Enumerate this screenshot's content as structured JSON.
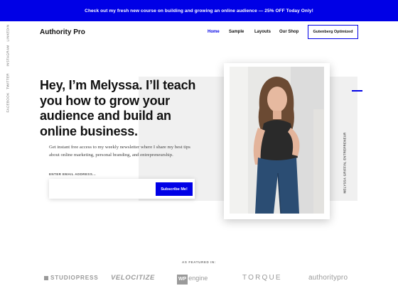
{
  "promo": {
    "text": "Check out my fresh new course on building and growing an online audience — 25% OFF Today Only!"
  },
  "site": {
    "title": "Authority Pro"
  },
  "nav": {
    "items": [
      {
        "label": "Home",
        "active": true
      },
      {
        "label": "Sample",
        "active": false
      },
      {
        "label": "Layouts",
        "active": false
      },
      {
        "label": "Our Shop",
        "active": false
      }
    ],
    "cta_label": "Gutenberg Optimized"
  },
  "social": {
    "items": [
      "LINKEDIN",
      "INSTAGRAM",
      "TWITTER",
      "FACEBOOK"
    ]
  },
  "hero": {
    "headline": "Hey, I’m Melyssa. I’ll teach you how to grow your audience and build an online business.",
    "intro": "Get instant free access to my weekly newsletter where I share my best tips about online marketing, personal branding, and entrepreneurship.",
    "email_label": "ENTER EMAIL ADDRESS...",
    "email_value": "",
    "email_placeholder": "",
    "subscribe_label": "Subscribe Me!",
    "photo_credit": "MELYSSA GRIFFIN, ENTREPRENEUR"
  },
  "featured": {
    "label": "AS FEATURED IN:",
    "logos": {
      "studiopress": "STUDIOPRESS",
      "velocitize": "VELOCITIZE",
      "wpengine_wp": "WP",
      "wpengine_name": "engine",
      "torque": "TORQUE",
      "authoritypro": "authoritypro"
    }
  },
  "colors": {
    "accent": "#0000e6",
    "text": "#111111",
    "panel": "#f0f0f0",
    "muted": "#9a9a9a"
  }
}
